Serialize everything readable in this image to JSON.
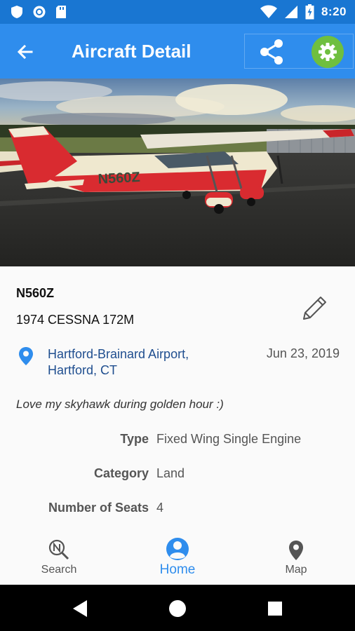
{
  "status_bar": {
    "time": "8:20"
  },
  "app_bar": {
    "title": "Aircraft Detail"
  },
  "aircraft": {
    "registration": "N560Z",
    "model": "1974 CESSNA 172M",
    "location_line1": "Hartford-Brainard Airport,",
    "location_line2": "Hartford, CT",
    "date": "Jun 23, 2019",
    "caption": "Love my skyhawk during golden hour :)",
    "tail_number": "N560Z"
  },
  "details": [
    {
      "label": "Type",
      "value": "Fixed Wing Single Engine"
    },
    {
      "label": "Category",
      "value": "Land"
    },
    {
      "label": "Number of Seats",
      "value": "4"
    }
  ],
  "bottom_nav": {
    "search": "Search",
    "home": "Home",
    "map": "Map"
  },
  "colors": {
    "status_bar": "#1976d2",
    "app_bar": "#2f8ded",
    "settings_button": "#6fbf3f",
    "location_text": "#1f4e8f",
    "pin": "#2f8ded"
  },
  "icons": {
    "back": "arrow-left-icon",
    "share": "share-icon",
    "settings": "gear-icon",
    "edit": "pencil-icon",
    "location": "map-pin-icon",
    "search_nav": "search-n-icon",
    "home_nav": "person-circle-icon",
    "map_nav": "map-pin-icon"
  }
}
